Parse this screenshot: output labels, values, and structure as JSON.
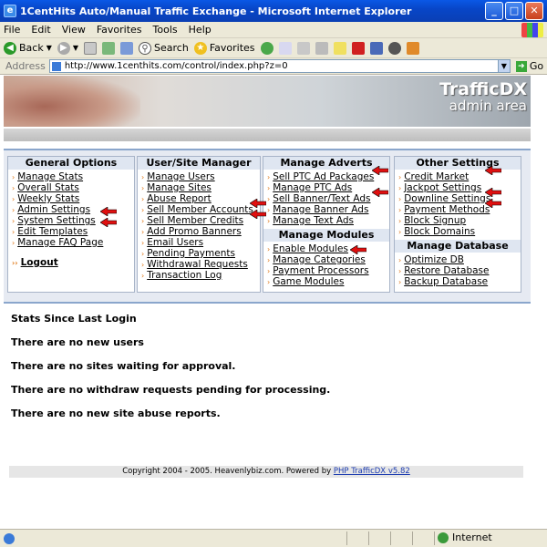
{
  "window": {
    "title": "1CentHits Auto/Manual Traffic Exchange - Microsoft Internet Explorer"
  },
  "menubar": [
    "File",
    "Edit",
    "View",
    "Favorites",
    "Tools",
    "Help"
  ],
  "toolbar": {
    "back": "Back",
    "search": "Search",
    "favorites": "Favorites"
  },
  "address": {
    "label": "Address",
    "url": "http://www.1centhits.com/control/index.php?z=0",
    "go": "Go"
  },
  "banner": {
    "brand": "TrafficDX",
    "subtitle": "admin area"
  },
  "columns": {
    "general": {
      "title": "General Options",
      "items": [
        "Manage Stats",
        "Overall Stats",
        "Weekly Stats",
        "Admin Settings",
        "System Settings",
        "Edit Templates",
        "Manage FAQ Page"
      ],
      "logout": "Logout"
    },
    "user": {
      "title": "User/Site Manager",
      "items": [
        "Manage Users",
        "Manage Sites",
        "Abuse Report",
        "Sell Member Accounts",
        "Sell Member Credits",
        "Add Promo Banners",
        "Email Users",
        "Pending Payments",
        "Withdrawal Requests",
        "Transaction Log"
      ]
    },
    "adverts": {
      "title": "Manage Adverts",
      "items": [
        "Sell PTC Ad Packages",
        "Manage PTC Ads",
        "Sell Banner/Text Ads",
        "Manage Banner Ads",
        "Manage Text Ads"
      ],
      "modules_title": "Manage Modules",
      "modules": [
        "Enable Modules",
        "Manage Categories",
        "Payment Processors",
        "Game Modules"
      ]
    },
    "other": {
      "title": "Other Settings",
      "items": [
        "Credit Market",
        "Jackpot Settings",
        "Downline Settings",
        "Payment Methods",
        "Block Signup",
        "Block Domains"
      ],
      "db_title": "Manage Database",
      "db": [
        "Optimize DB",
        "Restore Database",
        "Backup Database"
      ]
    }
  },
  "stats": {
    "heading": "Stats Since Last Login",
    "users": "There are no new users",
    "sites": "There are no sites waiting for approval.",
    "withdraw": "There are no withdraw requests pending for processing.",
    "abuse": "There are no new site abuse reports."
  },
  "footer": {
    "text": "Copyright 2004 - 2005. Heavenlybiz.com. Powered by ",
    "link": "PHP TrafficDX v5.82"
  },
  "statusbar": {
    "zone": "Internet"
  },
  "colors": {
    "arrow": "#e01010",
    "bullet": "#e07818",
    "header_bg": "#dfe6f1"
  }
}
